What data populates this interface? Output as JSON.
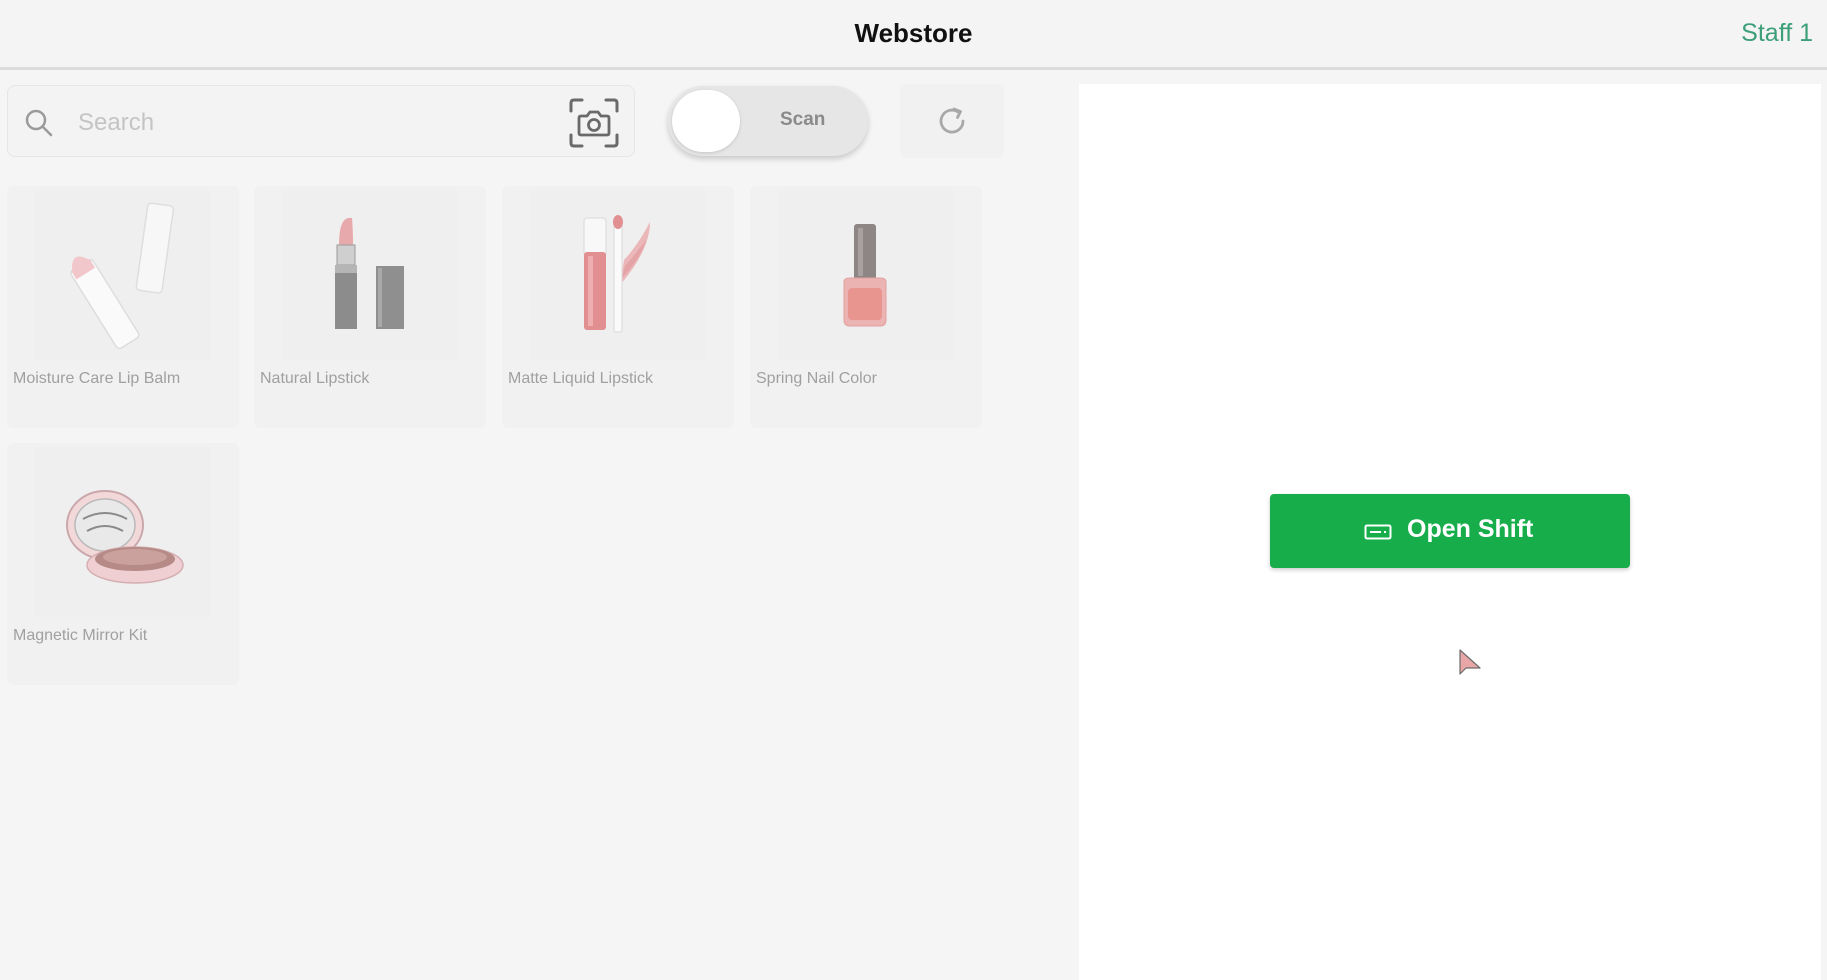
{
  "header": {
    "title": "Webstore",
    "staff": "Staff 1"
  },
  "search": {
    "placeholder": "Search",
    "value": ""
  },
  "scan_toggle": {
    "label": "Scan",
    "on": false
  },
  "products": [
    {
      "name": "Moisture Care Lip Balm"
    },
    {
      "name": "Natural Lipstick"
    },
    {
      "name": "Matte Liquid Lipstick"
    },
    {
      "name": "Spring Nail Color"
    },
    {
      "name": "Magnetic Mirror Kit"
    }
  ],
  "shift": {
    "button_label": "Open Shift"
  },
  "icons": {
    "search": "search-icon",
    "camera": "camera-icon",
    "refresh": "refresh-icon",
    "shift": "cash-drawer-icon",
    "cursor": "mouse-cursor-icon"
  },
  "colors": {
    "accent_green": "#17ad4b",
    "staff_text": "#3d9f7a"
  }
}
